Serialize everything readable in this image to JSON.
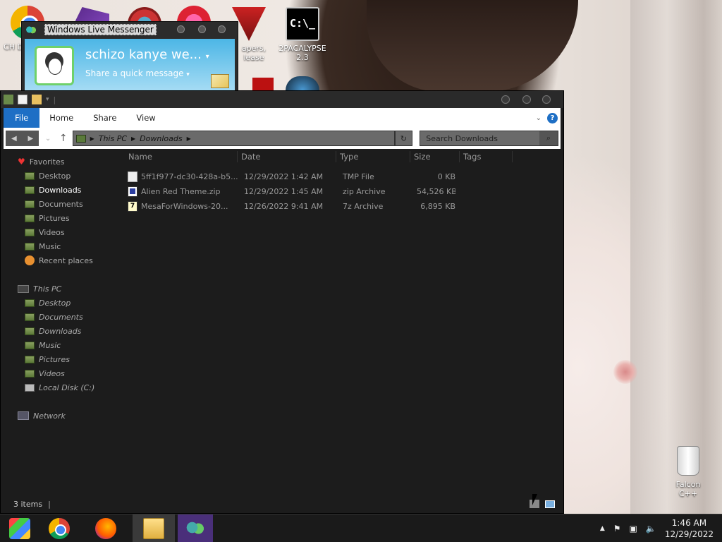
{
  "desktop": {
    "icons": [
      {
        "label": "CH D"
      },
      {
        "label": "apers, lease"
      },
      {
        "label": "2PACALYPSE 2.3"
      },
      {
        "label": "Falcon C++"
      }
    ]
  },
  "messenger": {
    "window_title": "Windows Live Messenger",
    "display_name": "schizo kanye we...",
    "status_prompt": "Share a quick message"
  },
  "explorer": {
    "ribbon": {
      "tabs": [
        "File",
        "Home",
        "Share",
        "View"
      ],
      "help": "?"
    },
    "address": {
      "segments": [
        "This PC",
        "Downloads"
      ]
    },
    "search": {
      "placeholder": "Search Downloads"
    },
    "nav": {
      "favorites_label": "Favorites",
      "favorites": [
        "Desktop",
        "Downloads",
        "Documents",
        "Pictures",
        "Videos",
        "Music",
        "Recent places"
      ],
      "thispc_label": "This PC",
      "thispc": [
        "Desktop",
        "Documents",
        "Downloads",
        "Music",
        "Pictures",
        "Videos",
        "Local Disk (C:)"
      ],
      "network_label": "Network"
    },
    "columns": {
      "name": "Name",
      "date": "Date",
      "type": "Type",
      "size": "Size",
      "tags": "Tags"
    },
    "files": [
      {
        "name": "5ff1f977-dc30-428a-b5...",
        "date": "12/29/2022 1:42 AM",
        "type": "TMP File",
        "size": "0 KB"
      },
      {
        "name": "Alien Red Theme.zip",
        "date": "12/29/2022 1:45 AM",
        "type": "zip Archive",
        "size": "54,526 KB"
      },
      {
        "name": "MesaForWindows-20...",
        "date": "12/26/2022 9:41 AM",
        "type": "7z Archive",
        "size": "6,895 KB"
      }
    ],
    "status": {
      "items_count": "3 items"
    }
  },
  "taskbar": {
    "clock": {
      "time": "1:46 AM",
      "date": "12/29/2022"
    }
  }
}
